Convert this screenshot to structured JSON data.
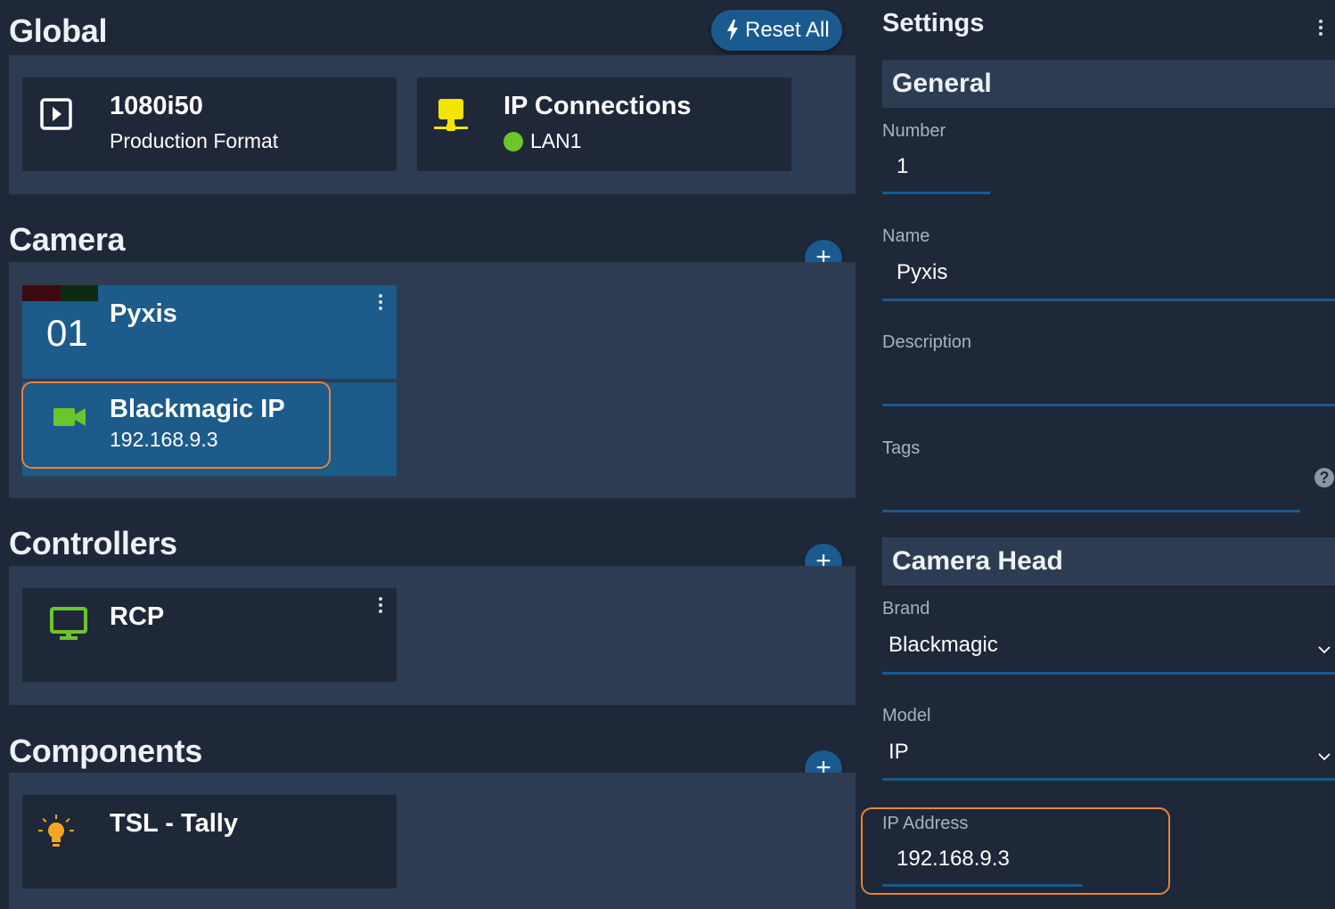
{
  "global": {
    "title": "Global",
    "reset_label": "Reset All",
    "format_card": {
      "value": "1080i50",
      "label": "Production Format"
    },
    "ip_card": {
      "title": "IP Connections",
      "status": "LAN1",
      "status_color": "#6cc52b"
    }
  },
  "camera": {
    "title": "Camera",
    "card": {
      "number": "01",
      "name": "Pyxis"
    },
    "head": {
      "name": "Blackmagic IP",
      "ip": "192.168.9.3"
    }
  },
  "controllers": {
    "title": "Controllers",
    "card": {
      "name": "RCP"
    }
  },
  "components": {
    "title": "Components",
    "card": {
      "name": "TSL - Tally"
    }
  },
  "settings": {
    "title": "Settings",
    "general": {
      "header": "General",
      "number": {
        "label": "Number",
        "value": "1"
      },
      "name": {
        "label": "Name",
        "value": "Pyxis"
      },
      "description": {
        "label": "Description",
        "value": ""
      },
      "tags": {
        "label": "Tags",
        "value": ""
      }
    },
    "camera_head": {
      "header": "Camera Head",
      "brand": {
        "label": "Brand",
        "value": "Blackmagic"
      },
      "model": {
        "label": "Model",
        "value": "IP"
      },
      "ip_address": {
        "label": "IP Address",
        "value": "192.168.9.3"
      }
    }
  },
  "colors": {
    "background": "#1f2839",
    "panel": "#2e3c53",
    "accent": "#1a5a8e",
    "highlight": "#e8833a",
    "green_icon": "#6cc52b",
    "yellow_icon": "#f2e600",
    "orange_icon": "#f5a623"
  },
  "icons": [
    "play-icon",
    "network-icon",
    "video-camera-icon",
    "monitor-icon",
    "lightbulb-icon",
    "lightning-icon",
    "plus-icon",
    "kebab-menu-icon",
    "chevron-down-icon",
    "help-icon"
  ]
}
